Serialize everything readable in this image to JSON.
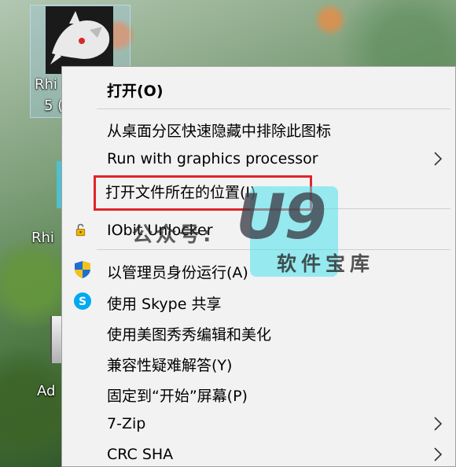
{
  "desktop": {
    "icons": [
      {
        "label": "Rhi"
      },
      {
        "label": "5 ("
      },
      {
        "label": "Rhi"
      },
      {
        "label": "Ad"
      }
    ]
  },
  "context_menu": {
    "items": [
      {
        "label": "打开(O)",
        "bold": true,
        "icon": null,
        "submenu": false
      },
      {
        "label": "从桌面分区快速隐藏中排除此图标",
        "icon": null,
        "submenu": false
      },
      {
        "label": "Run with graphics processor",
        "icon": null,
        "submenu": true
      },
      {
        "label": "打开文件所在的位置(I)",
        "icon": null,
        "submenu": false,
        "highlighted": true
      },
      {
        "label": "IObit Unlocker",
        "icon": "lock-icon",
        "submenu": false
      },
      {
        "label": "以管理员身份运行(A)",
        "icon": "uac-shield-icon",
        "submenu": false
      },
      {
        "label": "使用 Skype 共享",
        "icon": "skype-icon",
        "submenu": false
      },
      {
        "label": "使用美图秀秀编辑和美化",
        "icon": null,
        "submenu": false
      },
      {
        "label": "兼容性疑难解答(Y)",
        "icon": null,
        "submenu": false
      },
      {
        "label": "固定到“开始”屏幕(P)",
        "icon": null,
        "submenu": false
      },
      {
        "label": "7-Zip",
        "icon": null,
        "submenu": true
      },
      {
        "label": "CRC SHA",
        "icon": null,
        "submenu": true
      }
    ]
  },
  "watermark": {
    "big": "U9",
    "left": "公众号:",
    "sub": "软件宝库"
  },
  "colors": {
    "menu_bg": "#f2f2f2",
    "highlight_border": "#e0242a",
    "watermark_cyan": "#4be1eb"
  }
}
